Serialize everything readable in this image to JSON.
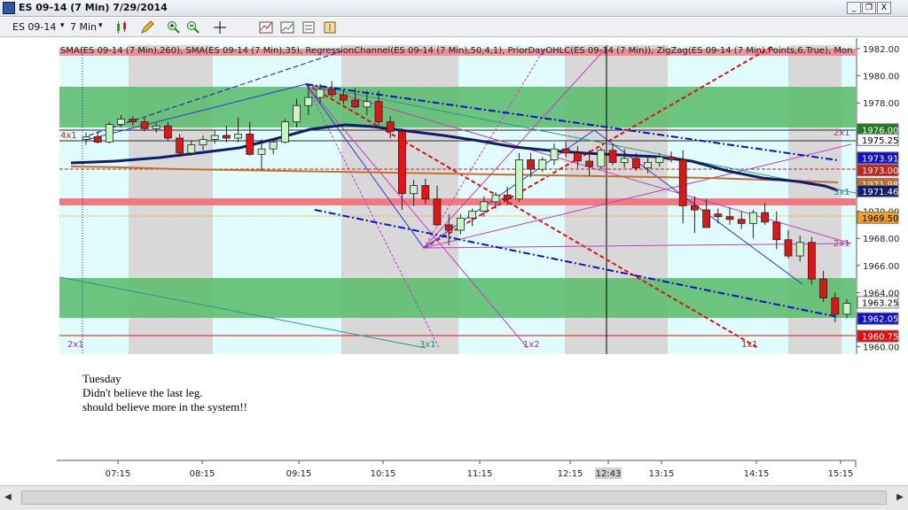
{
  "window": {
    "title": "ES 09-14 (7 Min)  7/29/2014",
    "minimize_glyph": "_",
    "restore_glyph": "❐",
    "close_glyph": "X"
  },
  "toolbar": {
    "instrument": "ES 09-14",
    "interval": "7 Min",
    "dropdown_glyph": "▾",
    "icons": [
      "candlestick-chart-icon",
      "drawing-pencil-icon",
      "zoom-in-icon",
      "zoom-out-icon",
      "crosshair-icon",
      "indicators-icon",
      "strategies-icon",
      "chart-properties-icon",
      "data-box-icon"
    ]
  },
  "chart": {
    "indicator_header": "SMA(ES 09-14 (7 Min),260), SMA(ES 09-14 (7 Min),35), RegressionChannel(ES 09-14 (7 Min),50,4,1), PriorDayOHLC(ES 09-14 (7 Min)), ZigZag(ES 09-14 (7 Min),Points,6,True), Mon",
    "price_ticks": [
      "1982.00",
      "1980.00",
      "1978.00",
      "1976.00",
      "1974.00",
      "1972.00",
      "1970.00",
      "1968.00",
      "1966.00",
      "1964.00",
      "1962.00",
      "1960.00"
    ],
    "price_labels": [
      {
        "text": "1976.00",
        "value": 1976.0,
        "bg": "#1f7a1f",
        "fg": "#ffffff"
      },
      {
        "text": "1975.25",
        "value": 1975.25,
        "bg": "#ffffff",
        "fg": "#000000"
      },
      {
        "text": "1973.91",
        "value": 1973.91,
        "bg": "#1010c8",
        "fg": "#ffffff"
      },
      {
        "text": "1973.00",
        "value": 1973.0,
        "bg": "#c1251c",
        "fg": "#ffffff"
      },
      {
        "text": "1971.98",
        "value": 1971.98,
        "bg": "#c8702a",
        "fg": "#ffffff"
      },
      {
        "text": "1971.46",
        "value": 1971.46,
        "bg": "#101c6e",
        "fg": "#ffffff"
      },
      {
        "text": "1969.50",
        "value": 1969.5,
        "bg": "#f0a020",
        "fg": "#000000"
      },
      {
        "text": "1963.25",
        "value": 1963.25,
        "bg": "#ffffff",
        "fg": "#000000"
      },
      {
        "text": "1962.05",
        "value": 1962.05,
        "bg": "#1010c8",
        "fg": "#ffffff"
      },
      {
        "text": "1960.75",
        "value": 1960.75,
        "bg": "#e01010",
        "fg": "#ffffff"
      }
    ],
    "gann_labels": [
      "2x1",
      "3x1",
      "1x2",
      "1x1",
      "2x1",
      "3x1",
      "2x1",
      "4x1"
    ],
    "colors": {
      "up_candle": "#c8f5c0",
      "down_candle": "#e01515",
      "sma260": "#c8702a",
      "sma35": "#101c6e",
      "regression": "#1010c8",
      "prior_high": "#c1251c",
      "green_band": "#5fbf70",
      "red_band": "#f07a80",
      "day_shade": "#d8d8d8",
      "light_shade": "#e0fcfc"
    }
  },
  "notes": {
    "lines": [
      "Tuesday",
      "Didn't believe the last leg.",
      "should believe more in the system!!"
    ]
  },
  "time_axis": {
    "labels": [
      "07:15",
      "08:15",
      "09:15",
      "10:15",
      "11:15",
      "12:15",
      "12:43",
      "13:15",
      "14:15",
      "15:15"
    ]
  },
  "scrollbar": {
    "left_arrow": "◀",
    "right_arrow": "▶"
  }
}
